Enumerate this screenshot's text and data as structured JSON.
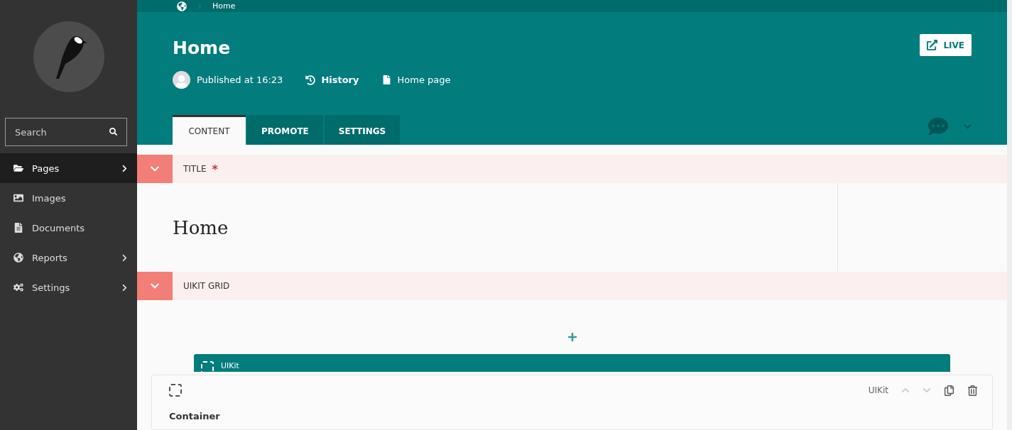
{
  "sidebar": {
    "search": {
      "placeholder": "Search"
    },
    "items": [
      {
        "label": "Pages",
        "selected": true,
        "has_children": true
      },
      {
        "label": "Images",
        "selected": false,
        "has_children": false
      },
      {
        "label": "Documents",
        "selected": false,
        "has_children": false
      },
      {
        "label": "Reports",
        "selected": false,
        "has_children": true
      },
      {
        "label": "Settings",
        "selected": false,
        "has_children": true
      }
    ]
  },
  "breadcrumb": {
    "items": [
      "Home"
    ]
  },
  "header": {
    "title": "Home",
    "status": "Published at 16:23",
    "history": "History",
    "page_type": "Home page",
    "live_button": "LIVE"
  },
  "tabs": [
    {
      "label": "CONTENT",
      "selected": true
    },
    {
      "label": "PROMOTE",
      "selected": false
    },
    {
      "label": "SETTINGS",
      "selected": false
    }
  ],
  "title_panel": {
    "label": "TITLE",
    "required": true,
    "required_mark": "*",
    "expanded": true,
    "value": "Home"
  },
  "grid_panel": {
    "label": "UIKIT GRID",
    "expanded": true,
    "block_bar": {
      "label": "UIKit"
    },
    "block_card": {
      "type_label": "UIKit",
      "heading": "Container"
    }
  }
}
